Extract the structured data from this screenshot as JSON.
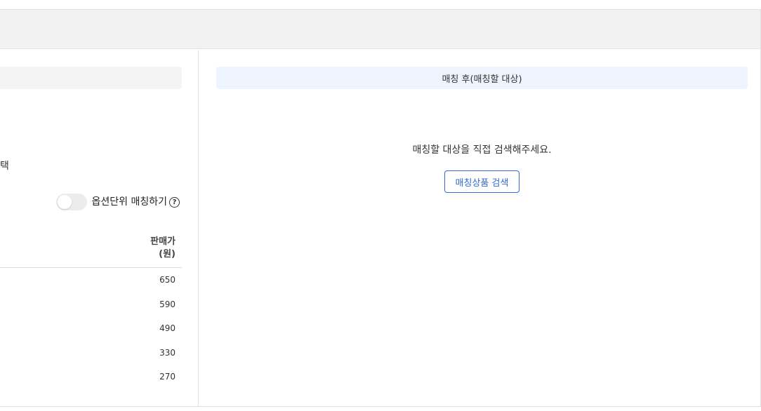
{
  "left_panel": {
    "select_text_fragment": "택",
    "option_toggle": {
      "label": "옵션단위 매칭하기",
      "help_icon": "help-circle-icon",
      "on": false
    },
    "table": {
      "price_header_line1": "판매가",
      "price_header_line2": "(원)",
      "prices": [
        "650",
        "590",
        "490",
        "330",
        "270"
      ]
    }
  },
  "right_panel": {
    "header_title": "매칭 후(매칭할 대상)",
    "empty_message": "매칭할 대상을 직접 검색해주세요.",
    "search_button_label": "매칭상품 검색"
  },
  "colors": {
    "accent": "#2f6bd2",
    "right_header_bg": "#eef4fd",
    "header_band_bg": "#f2f2f2"
  }
}
